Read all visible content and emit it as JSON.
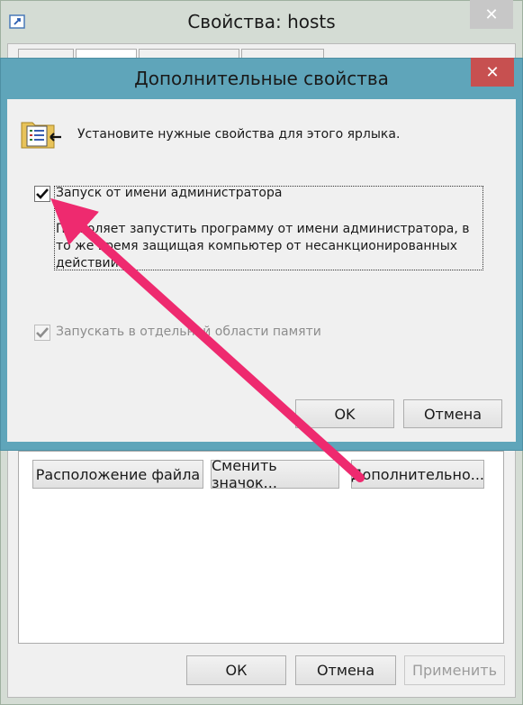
{
  "background_window": {
    "title": "Свойства: hosts",
    "close_glyph": "✕",
    "buttons": {
      "file_location": "Расположение файла",
      "change_icon": "Сменить значок...",
      "advanced": "Дополнительно...",
      "ok": "ОК",
      "cancel": "Отмена",
      "apply": "Применить"
    }
  },
  "dialog": {
    "title": "Дополнительные свойства",
    "close_glyph": "✕",
    "intro": "Установите нужные свойства для этого ярлыка.",
    "run_as_admin": {
      "label": "Запуск от имени администратора",
      "checked": true,
      "description": "Позволяет запустить программу от имени администратора, в то же время защищая компьютер от несанкционированных действий."
    },
    "separate_memory": {
      "label": "Запускать в отдельной области памяти",
      "checked": true,
      "disabled": true
    },
    "ok": "OK",
    "cancel": "Отмена"
  },
  "icons": [
    "app-shortcut-icon",
    "properties-shortcut-icon",
    "close-icon",
    "check-icon"
  ],
  "colors": {
    "dialog_frame": "#5fa5ba",
    "close_active": "#c75050",
    "annotation_arrow": "#ee2a6f"
  }
}
